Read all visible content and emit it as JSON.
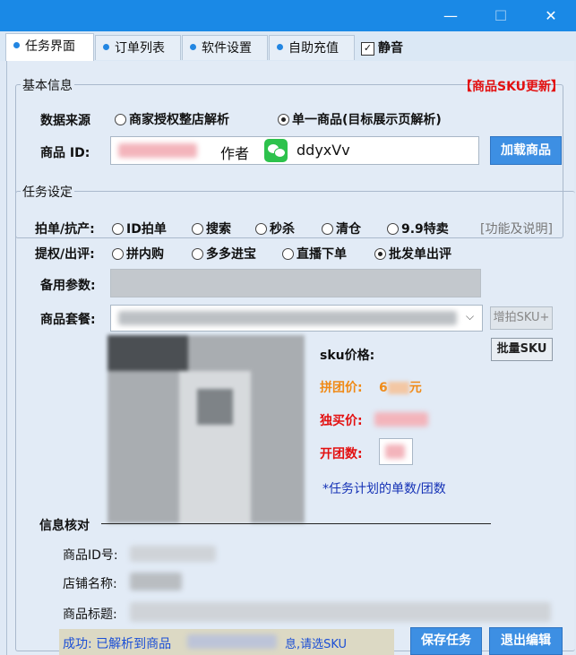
{
  "window": {
    "minimize": "—",
    "maximize": "☐",
    "close": "✕"
  },
  "tabs": [
    {
      "label": "任务界面",
      "active": true
    },
    {
      "label": "订单列表",
      "active": false
    },
    {
      "label": "软件设置",
      "active": false
    },
    {
      "label": "自助充值",
      "active": false
    }
  ],
  "mute": {
    "label": "静音",
    "checked": true
  },
  "basic_info": {
    "legend": "基本信息",
    "sku_update": "【商品SKU更新】",
    "source_label": "数据来源",
    "source_options": [
      {
        "label": "商家授权整店解析",
        "selected": false
      },
      {
        "label": "单一商品(目标展示页解析)",
        "selected": true
      }
    ],
    "product_id_label": "商品 ID:",
    "product_id_suffix": "作者",
    "wechat_id": "ddyxVv",
    "load_button": "加载商品"
  },
  "task": {
    "legend": "任务设定",
    "row1_label": "拍单/抗产:",
    "row1_options": [
      {
        "label": "ID拍单",
        "selected": false
      },
      {
        "label": "搜索",
        "selected": false
      },
      {
        "label": "秒杀",
        "selected": false
      },
      {
        "label": "清仓",
        "selected": false
      },
      {
        "label": "9.9特卖",
        "selected": false
      }
    ],
    "help_link": "[功能及说明]",
    "row2_label": "提权/出评:",
    "row2_options": [
      {
        "label": "拼内购",
        "selected": false
      },
      {
        "label": "多多进宝",
        "selected": false
      },
      {
        "label": "直播下单",
        "selected": false
      },
      {
        "label": "批发单出评",
        "selected": true
      }
    ],
    "backup_label": "备用参数:",
    "package_label": "商品套餐:",
    "add_sku_button": "增拍SKU+",
    "batch_sku_button": "批量SKU",
    "sku_price_label": "sku价格:",
    "group_price_label": "拼团价:",
    "group_price_value": "6",
    "group_price_unit": "元",
    "solo_price_label": "独买价:",
    "group_count_label": "开团数:",
    "note": "*任务计划的单数/团数"
  },
  "verify": {
    "title": "信息核对",
    "product_id_label": "商品ID号:",
    "shop_label": "店铺名称:",
    "title_label": "商品标题:"
  },
  "status": {
    "text": "成功: 已解析到商品",
    "text2": "息,请选SKU"
  },
  "buttons": {
    "save": "保存任务",
    "exit": "退出编辑"
  }
}
